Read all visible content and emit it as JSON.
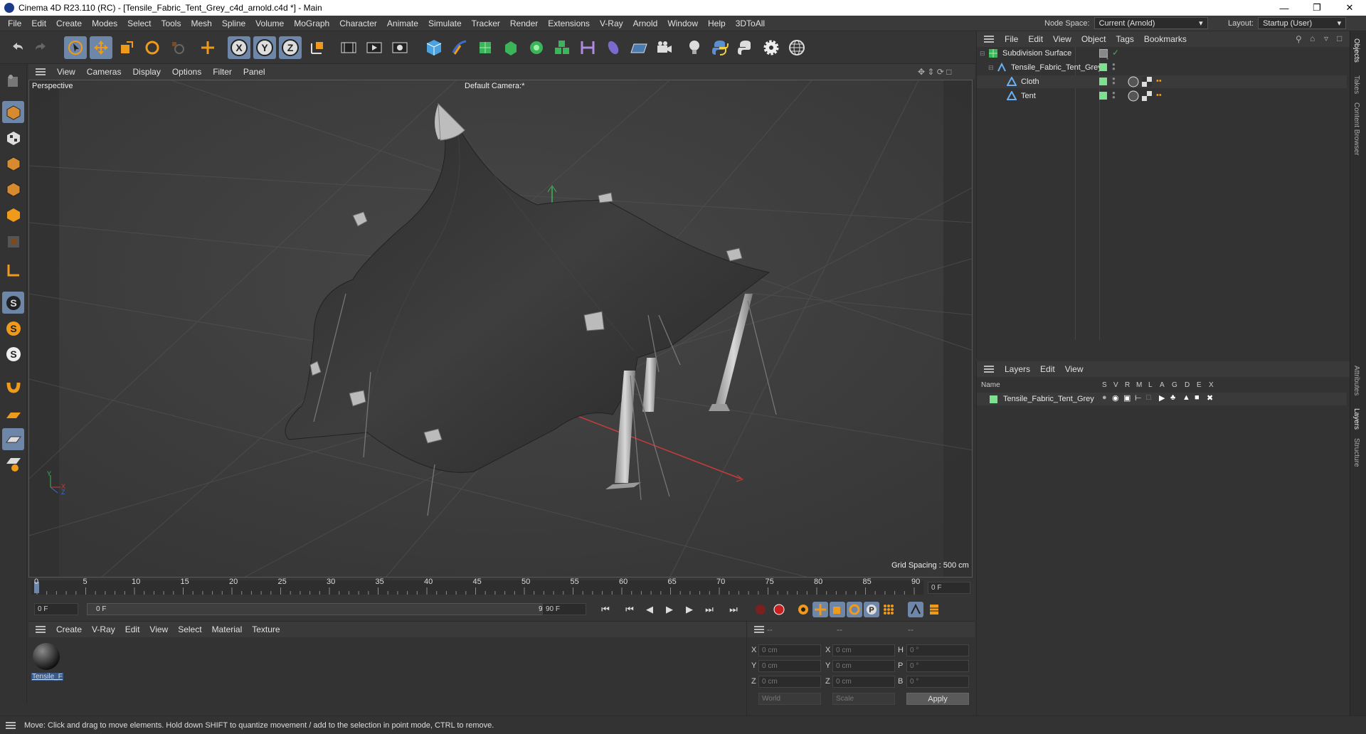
{
  "window": {
    "title": "Cinema 4D R23.110 (RC) - [Tensile_Fabric_Tent_Grey_c4d_arnold.c4d *] - Main"
  },
  "menu": {
    "items": [
      "File",
      "Edit",
      "Create",
      "Modes",
      "Select",
      "Tools",
      "Mesh",
      "Spline",
      "Volume",
      "MoGraph",
      "Character",
      "Animate",
      "Simulate",
      "Tracker",
      "Render",
      "Extensions",
      "V-Ray",
      "Arnold",
      "Window",
      "Help",
      "3DToAll"
    ],
    "node_space_label": "Node Space:",
    "node_space_value": "Current (Arnold)",
    "layout_label": "Layout:",
    "layout_value": "Startup (User)"
  },
  "toolbar": {
    "icons": [
      "undo-icon",
      "redo-icon",
      "live-select-icon",
      "move-icon",
      "scale-icon",
      "rotate-icon",
      "recent-tool-icon",
      "transform-icon",
      "x-axis-icon",
      "y-axis-icon",
      "z-axis-icon",
      "coordinate-system-icon",
      "render-view-icon",
      "render-picture-viewer-icon",
      "render-settings-icon",
      "cube-icon",
      "pen-icon",
      "subdivision-icon",
      "extrude-icon",
      "cloner-icon",
      "mograph-icon",
      "deformer-icon",
      "field-icon",
      "floor-icon",
      "camera-icon",
      "light-icon",
      "python-icon",
      "python-alt-icon",
      "gear-icon",
      "globe-icon"
    ],
    "axis_labels": [
      "X",
      "Y",
      "Z"
    ]
  },
  "viewport": {
    "menu": [
      "View",
      "Cameras",
      "Display",
      "Options",
      "Filter",
      "Panel"
    ],
    "view_name": "Perspective",
    "camera": "Default Camera",
    "camera_suffix": ":*",
    "grid_spacing": "Grid Spacing : 500 cm",
    "axis_x": "X",
    "axis_y": "Y",
    "axis_z": "Z"
  },
  "timeline": {
    "ticks": [
      "0",
      "5",
      "10",
      "15",
      "20",
      "25",
      "30",
      "35",
      "40",
      "45",
      "50",
      "55",
      "60",
      "65",
      "70",
      "75",
      "80",
      "85",
      "90"
    ],
    "current_frame": "0 F",
    "start_frame": "0 F",
    "range_start": "0 F",
    "range_end": "90 F",
    "end_frame": "90 F"
  },
  "material_manager": {
    "menu": [
      "Create",
      "V-Ray",
      "Edit",
      "View",
      "Select",
      "Material",
      "Texture"
    ],
    "materials": [
      {
        "name": "Tensile_F"
      }
    ]
  },
  "coordinates": {
    "headers": [
      "--",
      "--",
      "--"
    ],
    "pos_labels": [
      "X",
      "Y",
      "Z"
    ],
    "size_labels": [
      "X",
      "Y",
      "Z"
    ],
    "rot_labels": [
      "H",
      "P",
      "B"
    ],
    "pos_values": [
      "0 cm",
      "0 cm",
      "0 cm"
    ],
    "size_values": [
      "0 cm",
      "0 cm",
      "0 cm"
    ],
    "rot_values": [
      "0 °",
      "0 °",
      "0 °"
    ],
    "mode_world": "World",
    "mode_scale": "Scale",
    "apply": "Apply"
  },
  "object_manager": {
    "menu": [
      "File",
      "Edit",
      "View",
      "Object",
      "Tags",
      "Bookmarks"
    ],
    "objects": [
      {
        "name": "Subdivision Surface",
        "icon": "subdivision-icon"
      },
      {
        "name": "Tensile_Fabric_Tent_Grey",
        "icon": "null-icon"
      },
      {
        "name": "Cloth",
        "icon": "polygon-icon"
      },
      {
        "name": "Tent",
        "icon": "polygon-icon"
      }
    ]
  },
  "layer_manager": {
    "menu": [
      "Layers",
      "Edit",
      "View"
    ],
    "columns": [
      "Name",
      "S",
      "V",
      "R",
      "M",
      "L",
      "A",
      "G",
      "D",
      "E",
      "X"
    ],
    "layers": [
      {
        "name": "Tensile_Fabric_Tent_Grey",
        "color": "#7be08f"
      }
    ]
  },
  "right_tabs": [
    "Objects",
    "Takes",
    "Content Browser",
    "Attributes",
    "Layers",
    "Structure"
  ],
  "status": {
    "text": "Move: Click and drag to move elements. Hold down SHIFT to quantize movement / add to the selection in point mode, CTRL to remove."
  },
  "colors": {
    "accent": "#6e87a8",
    "orange": "#f09a1c",
    "green_tag": "#7be08f",
    "axis_red": "#c83c3c",
    "axis_green": "#3cb45a",
    "axis_blue": "#3c6ec8"
  }
}
